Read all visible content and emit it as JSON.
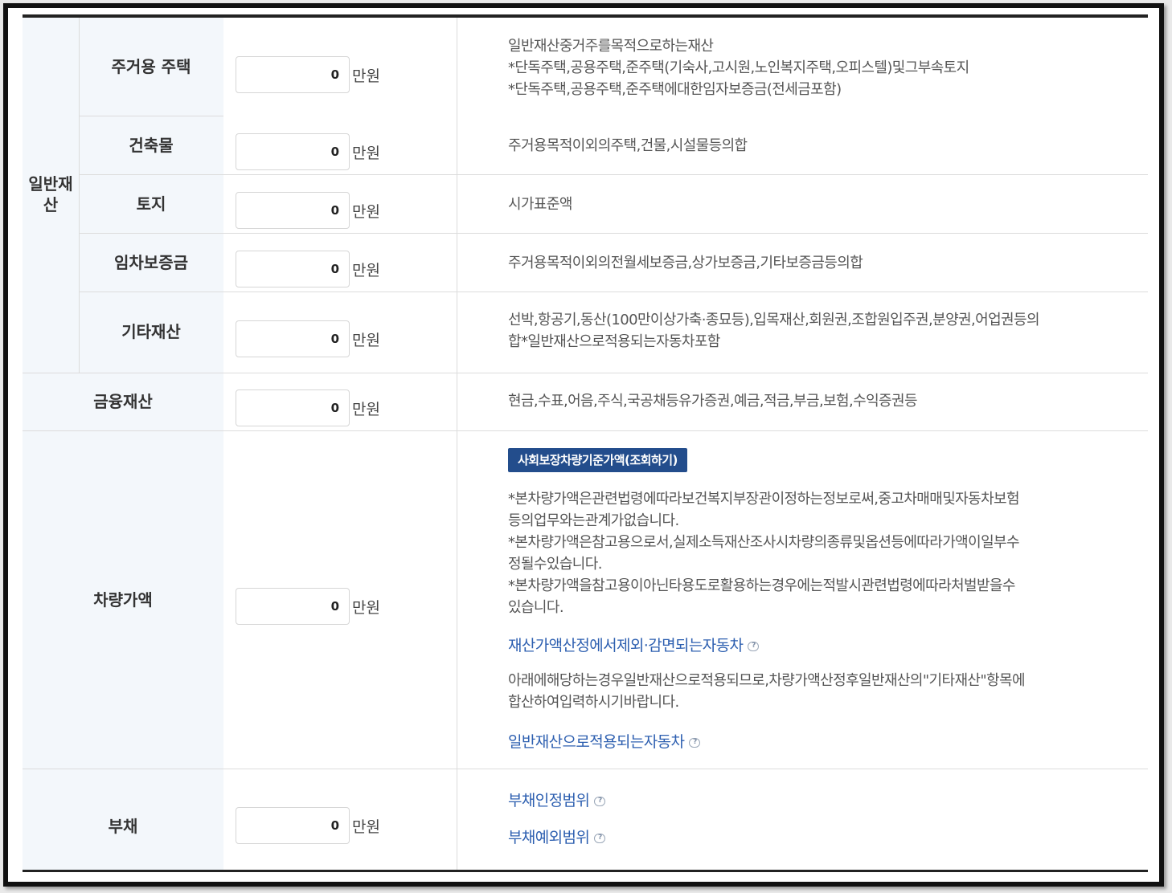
{
  "unit_label": "만원",
  "general_assets": {
    "group_label": "일반재산",
    "rows": [
      {
        "label": "주거용 주택",
        "value": "0",
        "desc": [
          "일반재산중거주를목적으로하는재산",
          "*단독주택,공용주택,준주택(기숙사,고시원,노인복지주택,오피스텔)및그부속토지",
          "*단독주택,공용주택,준주택에대한임자보증금(전세금포함)"
        ]
      },
      {
        "label": "건축물",
        "value": "0",
        "desc": [
          "주거용목적이외의주택,건물,시설물등의합"
        ]
      },
      {
        "label": "토지",
        "value": "0",
        "desc": [
          "시가표준액"
        ]
      },
      {
        "label": "임차보증금",
        "value": "0",
        "desc": [
          "주거용목적이외의전월세보증금,상가보증금,기타보증금등의합"
        ]
      },
      {
        "label": "기타재산",
        "value": "0",
        "desc": [
          "선박,항공기,동산(100만이상가축·종묘등),입목재산,회원권,조합원입주권,분양권,어업권등의",
          "합*일반재산으로적용되는자동차포함"
        ]
      }
    ]
  },
  "financial": {
    "label": "금융재산",
    "value": "0",
    "desc": [
      "현금,수표,어음,주식,국공채등유가증권,예금,적금,부금,보험,수익증권등"
    ]
  },
  "vehicle": {
    "label": "차량가액",
    "value": "0",
    "button": "사회보장차량기준가액(조회하기)",
    "notes": [
      "*본차량가액은관련법령에따라보건복지부장관이정하는정보로써,중고차매매및자동차보험",
      "등의업무와는관계가없습니다.",
      "*본차량가액은참고용으로서,실제소득재산조사시차량의종류및옵션등에따라가액이일부수",
      "정될수있습니다.",
      "*본차량가액을참고용이아닌타용도로활용하는경우에는적발시관련법령에따라처벌받을수",
      "있습니다."
    ],
    "link_excluded": "재산가액산정에서제외·감면되는자동차",
    "note2": [
      "아래에해당하는경우일반재산으로적용되므로,차량가액산정후일반재산의\"기타재산\"항목에",
      "합산하여입력하시기바랍니다."
    ],
    "link_general": "일반재산으로적용되는자동차"
  },
  "debt": {
    "label": "부채",
    "value": "0",
    "link_range": "부채인정범위",
    "link_exclusion": "부채예외범위"
  },
  "icons": {
    "help": "help-speech-icon"
  }
}
